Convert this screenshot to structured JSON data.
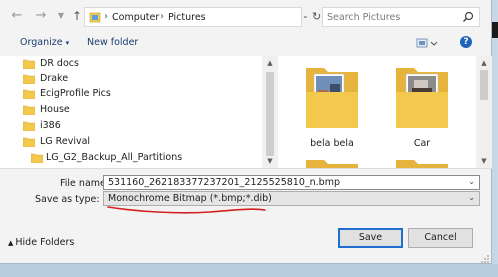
{
  "address_bar": {
    "back_icon": "back-arrow-icon",
    "forward_icon": "forward-arrow-icon",
    "path": [
      "Computer",
      "Pictures"
    ],
    "search_placeholder": "Search Pictures"
  },
  "toolbar": {
    "organize_label": "Organize",
    "new_folder_label": "New folder"
  },
  "nav_pane": {
    "items": [
      {
        "label": "DR docs"
      },
      {
        "label": "Drake"
      },
      {
        "label": "EcigProfile Pics"
      },
      {
        "label": "House"
      },
      {
        "label": "i386"
      },
      {
        "label": "LG Revival"
      },
      {
        "label": "LG_G2_Backup_All_Partitions"
      }
    ]
  },
  "content": {
    "tiles": [
      {
        "label": "bela bela"
      },
      {
        "label": "Car"
      },
      {
        "label": ""
      },
      {
        "label": ""
      }
    ]
  },
  "form": {
    "filename_label": "File name:",
    "filename_value": "531160_262183377237201_2125525810_n.bmp",
    "savetype_label": "Save as type:",
    "savetype_value": "Monochrome Bitmap (*.bmp;*.dib)"
  },
  "footer": {
    "hide_folders_label": "Hide Folders",
    "save_label": "Save",
    "cancel_label": "Cancel"
  },
  "colors": {
    "accent_blue": "#1e6fd0",
    "annotation_red": "#d42020",
    "folder_yellow": "#f2c94c"
  }
}
